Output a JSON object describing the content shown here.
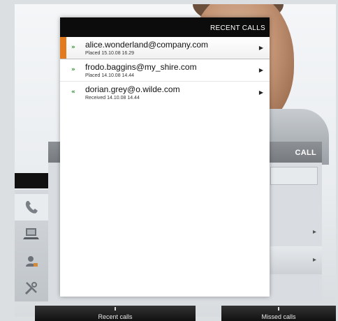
{
  "popup": {
    "title": "RECENT CALLS",
    "items": [
      {
        "direction": "placed",
        "direction_icon": "outgoing-call-icon",
        "name": "alice.wonderland@company.com",
        "meta": "Placed 15.10.08 16.29",
        "selected": true
      },
      {
        "direction": "placed",
        "direction_icon": "outgoing-call-icon",
        "name": "frodo.baggins@my_shire.com",
        "meta": "Placed 14.10.08 14.44",
        "selected": false
      },
      {
        "direction": "received",
        "direction_icon": "incoming-call-icon",
        "name": "dorian.grey@o.wilde.com",
        "meta": "Received 14.10.08 14.44",
        "selected": false
      }
    ]
  },
  "call_panel": {
    "title": "CALL"
  },
  "sidebar": {
    "items": [
      {
        "icon": "phone-icon"
      },
      {
        "icon": "laptop-icon"
      },
      {
        "icon": "contact-card-icon"
      },
      {
        "icon": "tools-icon"
      }
    ]
  },
  "bottom_bar": {
    "recent_label": "Recent calls",
    "missed_label": "Missed calls"
  },
  "colors": {
    "accent": "#e27a1e",
    "header": "#0c0c0c",
    "direction_arrow": "#2e8b2e"
  }
}
